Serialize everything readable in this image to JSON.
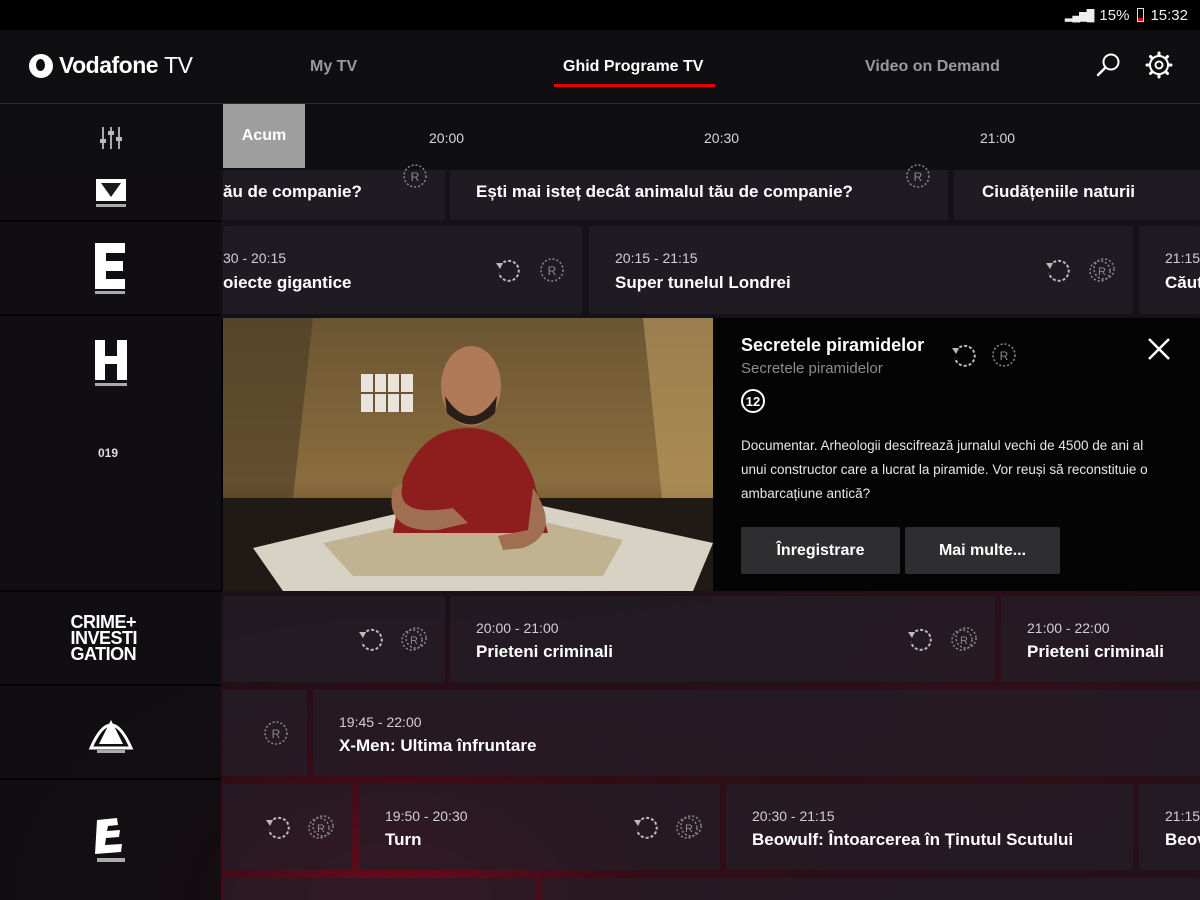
{
  "status_bar": {
    "battery": "15%",
    "time": "15:32"
  },
  "header": {
    "logo_brand": "Vodafone",
    "logo_product": "TV",
    "tabs": [
      {
        "label": "My TV"
      },
      {
        "label": "Ghid Programe TV"
      },
      {
        "label": "Video on Demand"
      }
    ],
    "active_tab": "Ghid Programe TV",
    "accent_color": "#e60000"
  },
  "timeline": {
    "now_label": "Acum",
    "times": [
      "20:00",
      "20:30",
      "21:00"
    ]
  },
  "channels": [
    {
      "logo": "RIVER / nature channel"
    },
    {
      "logo": "E / Viasat Explore"
    },
    {
      "logo": "H / Viasat History"
    },
    {
      "number": "019"
    },
    {
      "logo_text": "CRIME+ INVESTI GATION"
    },
    {
      "logo": "Paramount Channel"
    },
    {
      "logo": "E / Comedy/Cinema"
    }
  ],
  "rows": {
    "row1": [
      {
        "name": "ău de companie?"
      },
      {
        "name": "Ești mai isteț decât animalul tău de companie?"
      },
      {
        "name": "Ciudățeniile naturii"
      }
    ],
    "row2": [
      {
        "time": "30 - 20:15",
        "name": "oiecte gigantice"
      },
      {
        "time": "20:15 - 21:15",
        "name": "Super tunelul Londrei"
      },
      {
        "time": "21:15",
        "name": "Căut"
      }
    ],
    "row4": [
      {
        "time": "20:00 - 21:00",
        "name": "Prieteni criminali"
      },
      {
        "time": "21:00 - 22:00",
        "name": "Prieteni criminali"
      }
    ],
    "row5": [
      {
        "time": "19:45 - 22:00",
        "name": "X-Men: Ultima înfruntare"
      }
    ],
    "row6": [
      {
        "time": "19:50 - 20:30",
        "name": "Turn"
      },
      {
        "time": "20:30 - 21:15",
        "name": "Beowulf: Întoarcerea în Ținutul Scutului"
      },
      {
        "time": "21:15",
        "name": "Beov"
      }
    ]
  },
  "detail": {
    "title": "Secretele piramidelor",
    "subtitle": "Secretele piramidelor",
    "age_rating": "12",
    "description": "Documentar. Arheologii descifrează jurnalul vechi de 4500 de ani al unui constructor care a lucrat la piramide. Vor reuși să reconstituie o ambarcațiune antică?",
    "buttons": {
      "record": "Înregistrare",
      "more": "Mai multe..."
    }
  },
  "icons": [
    "search-icon",
    "gear-icon",
    "filter-icon",
    "replay-icon",
    "record-icon",
    "close-icon"
  ]
}
